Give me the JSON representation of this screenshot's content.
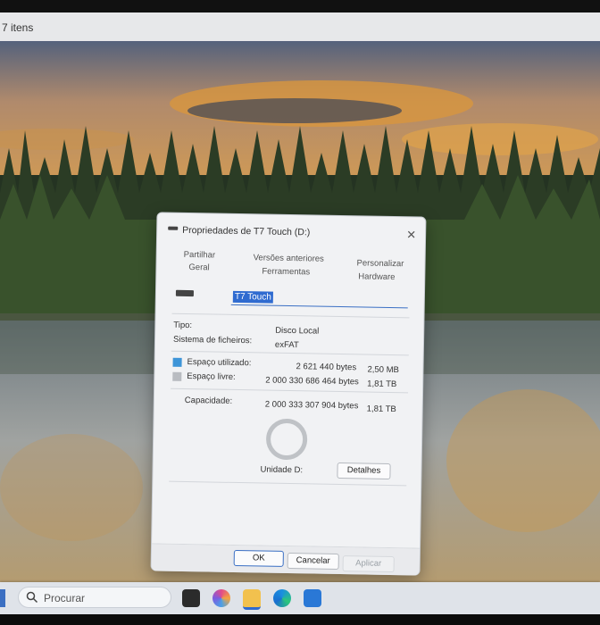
{
  "explorer": {
    "item_count": "7 itens"
  },
  "dialog": {
    "title": "Propriedades de T7 Touch (D:)",
    "close": "✕",
    "tabs": {
      "partilhar": "Partilhar",
      "geral": "Geral",
      "versoes": "Versões anteriores",
      "ferramentas": "Ferramentas",
      "personalizar": "Personalizar",
      "hardware": "Hardware"
    },
    "drive_name": "T7 Touch",
    "tipo_label": "Tipo:",
    "tipo_value": "Disco Local",
    "fs_label": "Sistema de ficheiros:",
    "fs_value": "exFAT",
    "used_label": "Espaço utilizado:",
    "used_bytes": "2 621 440 bytes",
    "used_size": "2,50 MB",
    "free_label": "Espaço livre:",
    "free_bytes": "2 000 330 686 464 bytes",
    "free_size": "1,81 TB",
    "cap_label": "Capacidade:",
    "cap_bytes": "2 000 333 307 904 bytes",
    "cap_size": "1,81 TB",
    "unit_label": "Unidade D:",
    "details_button": "Detalhes",
    "ok_button": "OK",
    "cancel_button": "Cancelar",
    "apply_button": "Aplicar"
  },
  "taskbar": {
    "search_placeholder": "Procurar"
  },
  "colors": {
    "used": "#3e95d8",
    "free": "#b9bcc1",
    "accent": "#2f6bd0"
  }
}
